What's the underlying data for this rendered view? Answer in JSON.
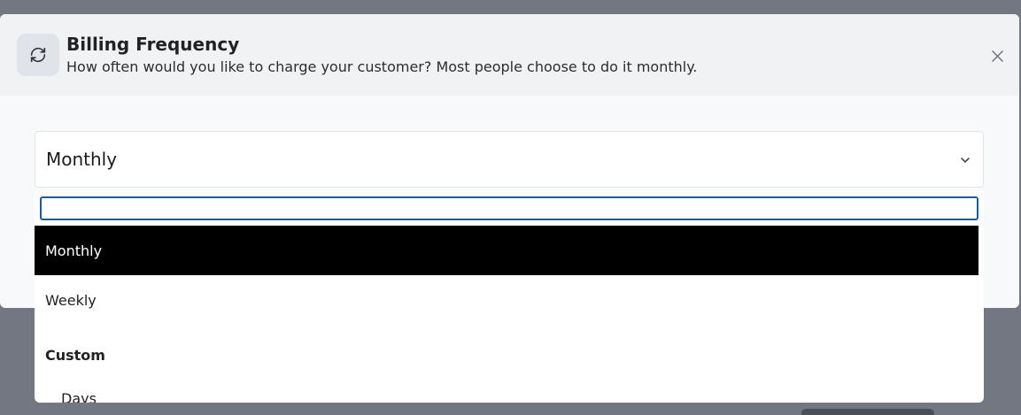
{
  "modal": {
    "title": "Billing Frequency",
    "subtitle": "How often would you like to charge your customer? Most people choose to do it monthly.",
    "header_icon": "refresh-icon",
    "close_icon": "close-icon"
  },
  "select": {
    "value": "Monthly",
    "chevron_icon": "chevron-down-icon"
  },
  "dropdown": {
    "search_value": "",
    "options": [
      {
        "label": "Monthly",
        "selected": true
      },
      {
        "label": "Weekly",
        "selected": false
      }
    ],
    "group": {
      "label": "Custom",
      "options": [
        {
          "label": "Days"
        }
      ]
    }
  },
  "colors": {
    "overlay": "#727782",
    "selected_bg": "#000000",
    "focus_border": "#1e5a94"
  }
}
